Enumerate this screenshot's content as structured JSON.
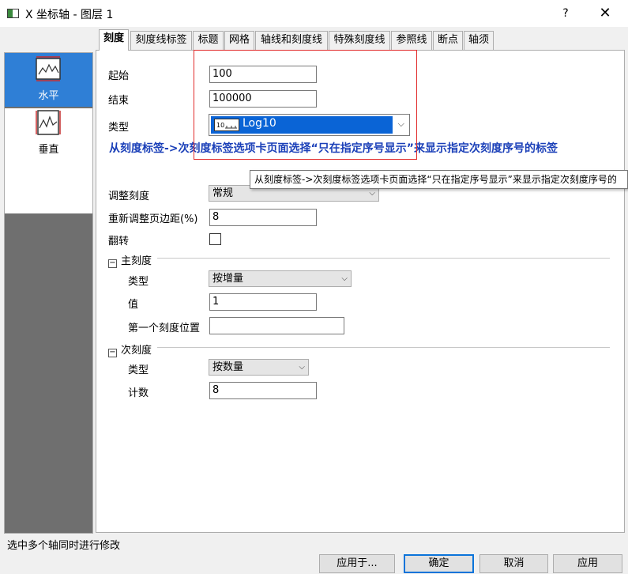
{
  "window": {
    "title": "X 坐标轴 - 图层 1",
    "help_label": "?",
    "close_label": "✕"
  },
  "tabs": [
    {
      "label": "刻度",
      "active": true
    },
    {
      "label": "刻度线标签"
    },
    {
      "label": "标题"
    },
    {
      "label": "网格"
    },
    {
      "label": "轴线和刻度线"
    },
    {
      "label": "特殊刻度线"
    },
    {
      "label": "参照线"
    },
    {
      "label": "断点"
    },
    {
      "label": "轴须"
    }
  ],
  "axis_list": [
    {
      "label": "水平",
      "selected": true
    },
    {
      "label": "垂直",
      "selected": false
    }
  ],
  "form": {
    "start_label": "起始",
    "start_value": "100",
    "end_label": "结束",
    "end_value": "100000",
    "type_label": "类型",
    "type_value": "Log10",
    "type_icon": "log-scale-icon",
    "hint": "从刻度标签->次刻度标签选项卡页面选择“只在指定序号显示”来显示指定次刻度序号的标签",
    "tooltip": "从刻度标签->次刻度标签选项卡页面选择“只在指定序号显示”来显示指定次刻度序号的",
    "rescale_label": "调整刻度",
    "rescale_value": "常规",
    "rescale_margin_label": "重新调整页边距(%)",
    "rescale_margin_value": "8",
    "reverse_label": "翻转",
    "reverse_checked": false
  },
  "major_ticks": {
    "heading": "主刻度",
    "expander": "−",
    "type_label": "类型",
    "type_value": "按增量",
    "value_label": "值",
    "value": "1",
    "anchor_label": "第一个刻度位置",
    "anchor_value": ""
  },
  "minor_ticks": {
    "heading": "次刻度",
    "expander": "−",
    "type_label": "类型",
    "type_value": "按数量",
    "count_label": "计数",
    "count_value": "8"
  },
  "status": {
    "text": "选中多个轴同时进行修改"
  },
  "buttons": {
    "apply_to": "应用于...",
    "ok": "确定",
    "cancel": "取消",
    "apply": "应用"
  },
  "colors": {
    "selected_bg": "#2f7fd6",
    "highlight_border": "#e12b2b",
    "hint_text": "#1a3fb8",
    "dropdown_selection": "#0a64d6"
  }
}
